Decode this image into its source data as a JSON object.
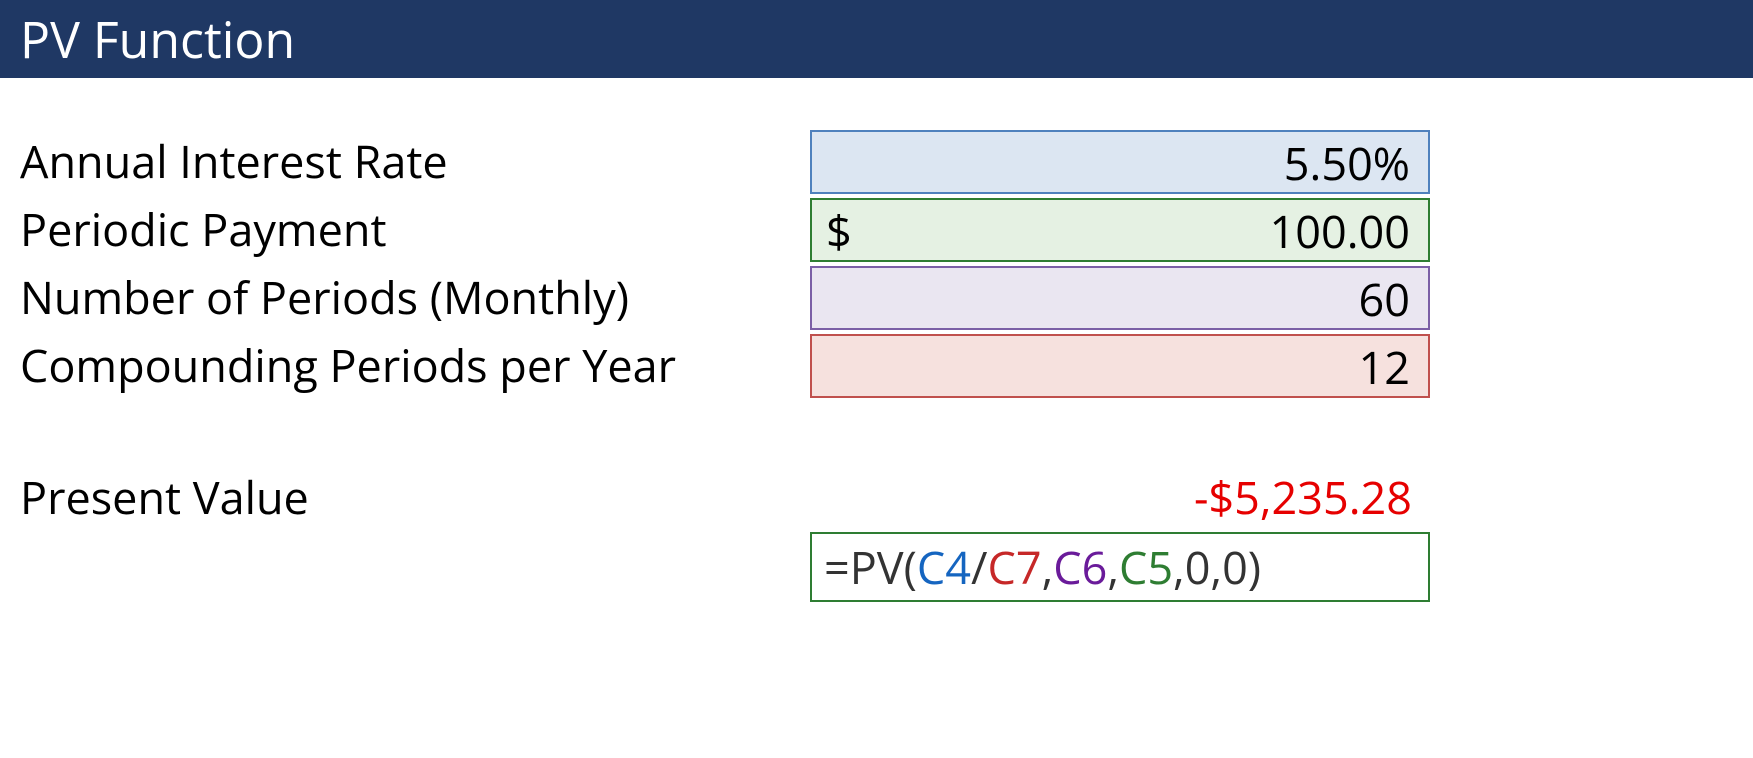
{
  "header": {
    "title": "PV Function"
  },
  "rows": {
    "rate": {
      "label": "Annual Interest Rate",
      "value": "5.50%"
    },
    "payment": {
      "label": "Periodic Payment",
      "currency": "$",
      "value": "100.00"
    },
    "periods": {
      "label": "Number of Periods (Monthly)",
      "value": "60"
    },
    "compound": {
      "label": "Compounding Periods per Year",
      "value": "12"
    }
  },
  "result": {
    "label": "Present Value",
    "value": "-$5,235.28"
  },
  "formula": {
    "prefix": "=PV(",
    "ref1": "C4",
    "slash": "/",
    "ref2": "C7",
    "comma1": ",",
    "ref3": "C6",
    "comma2": ",",
    "ref4": "C5",
    "suffix": ",0,0)"
  }
}
